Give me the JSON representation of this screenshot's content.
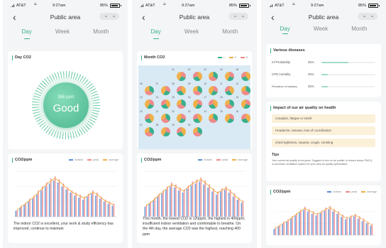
{
  "status_bar": {
    "carrier": "AT&T",
    "time": "9:27am",
    "battery": "85%"
  },
  "nav": {
    "title": "Public area"
  },
  "tabs": [
    "Day",
    "Week",
    "Month"
  ],
  "colors": {
    "accent": "#39b08d",
    "bottom": "#5b8fd6",
    "peak": "#ef8a8a",
    "average": "#f0b04a"
  },
  "screen1": {
    "active_tab": 0,
    "gauge": {
      "title": "Day CO2",
      "value": "356 ppm",
      "label": "Good"
    },
    "chart": {
      "title": "CO2/ppm"
    },
    "note": "The indoor CO2 is excellent, your work & study efficiency has improved, continue to maintain"
  },
  "screen2": {
    "active_tab": 2,
    "month": {
      "title": "Month CO2",
      "legend": [
        "1",
        "0",
        "8"
      ],
      "days": [
        {
          "d": "01"
        },
        {
          "d": "02"
        },
        {
          "d": "03"
        },
        {
          "d": "04"
        },
        {
          "d": "05"
        },
        {
          "d": "06"
        },
        {
          "d": "07"
        },
        {
          "d": "08"
        },
        {
          "d": "09"
        },
        {
          "d": "10"
        },
        {
          "d": "11"
        },
        {
          "d": "12"
        },
        {
          "d": "13"
        },
        {
          "d": "14"
        },
        {
          "d": "15"
        },
        {
          "d": "16"
        },
        {
          "d": "17"
        },
        {
          "d": "18"
        },
        {
          "d": "19"
        },
        {
          "d": "20"
        },
        {
          "d": "21"
        },
        {
          "d": "22"
        },
        {
          "d": "23"
        },
        {
          "d": "24"
        },
        {
          "d": "25"
        },
        {
          "d": "26"
        },
        {
          "d": "27"
        },
        {
          "d": "28"
        },
        {
          "d": "29"
        },
        {
          "d": "30"
        }
      ]
    },
    "chart": {
      "title": "CO2/ppm"
    },
    "note": "This month, the lowest CO2 is 120ppm, the highest is 400ppm, insufficient indoor ventilation and comfortable to breathe. On the 4th day, the average CO2 was the highest, reaching 400 ppm"
  },
  "screen3": {
    "active_tab": 0,
    "diseases": {
      "title": "Various diseases",
      "items": [
        {
          "name": "Inf Probability",
          "pct": "25%",
          "level": 0.5
        },
        {
          "name": "CPD mortality",
          "pct": "25%",
          "level": 0.12
        },
        {
          "name": "Prevalence of repiratory",
          "pct": "25%",
          "level": 0.12
        }
      ]
    },
    "impact": {
      "title": "Impact of our air quality on health",
      "items": [
        "complain, fatigue or smell",
        "Headache, nausea, loss of coordination",
        "chest tightness, nausea, cough, vomiting"
      ]
    },
    "tips": {
      "title": "Tips",
      "text": "Your current air quality is not good. Suggest to turn on air purifier to reduce indoor PM2.5, or purchase ventilation system for your area air quality optimization."
    },
    "chart": {
      "title": "CO2/ppm"
    }
  },
  "legend": {
    "bottom": "bottom",
    "peak": "peak",
    "average": "average"
  },
  "chart_data": [
    {
      "type": "bar",
      "title": "CO2/ppm",
      "series": [
        {
          "name": "bottom",
          "values": [
            12,
            18,
            24,
            30,
            36,
            44,
            52,
            60,
            66,
            72,
            68,
            60,
            54,
            48,
            42,
            38,
            34,
            40,
            46,
            42,
            36,
            30,
            26,
            22
          ]
        },
        {
          "name": "peak",
          "values": [
            14,
            22,
            28,
            36,
            42,
            52,
            60,
            68,
            76,
            80,
            74,
            66,
            58,
            52,
            48,
            44,
            40,
            46,
            52,
            48,
            40,
            34,
            30,
            26
          ]
        },
        {
          "name": "average",
          "values": [
            13,
            20,
            26,
            33,
            39,
            48,
            56,
            64,
            71,
            76,
            71,
            63,
            56,
            50,
            45,
            41,
            37,
            43,
            49,
            45,
            38,
            32,
            28,
            24
          ]
        }
      ]
    },
    {
      "type": "bar",
      "title": "CO2/ppm",
      "series": [
        {
          "name": "bottom",
          "values": [
            20,
            26,
            32,
            40,
            46,
            54,
            60,
            58,
            52,
            48,
            56,
            62,
            66,
            70,
            64,
            58,
            50,
            44,
            50,
            54,
            48,
            40,
            34,
            28
          ]
        },
        {
          "name": "peak",
          "values": [
            24,
            30,
            38,
            46,
            52,
            60,
            68,
            64,
            58,
            54,
            62,
            70,
            74,
            78,
            72,
            64,
            56,
            50,
            56,
            60,
            54,
            46,
            38,
            32
          ]
        },
        {
          "name": "average",
          "values": [
            22,
            28,
            35,
            43,
            49,
            57,
            64,
            61,
            55,
            51,
            59,
            66,
            70,
            74,
            68,
            61,
            53,
            47,
            53,
            57,
            51,
            43,
            36,
            30
          ]
        }
      ]
    },
    {
      "type": "bar",
      "title": "CO2/ppm",
      "series": [
        {
          "name": "bottom",
          "values": [
            16,
            22,
            28,
            34,
            42,
            50,
            58,
            64,
            60,
            54,
            50,
            56,
            62,
            66,
            60,
            54,
            46,
            40,
            44,
            48,
            42,
            36,
            30,
            24
          ]
        },
        {
          "name": "peak",
          "values": [
            20,
            26,
            34,
            40,
            48,
            56,
            64,
            72,
            66,
            60,
            56,
            62,
            70,
            74,
            66,
            60,
            52,
            46,
            50,
            54,
            48,
            42,
            34,
            28
          ]
        },
        {
          "name": "average",
          "values": [
            18,
            24,
            31,
            37,
            45,
            53,
            61,
            68,
            63,
            57,
            53,
            59,
            66,
            70,
            63,
            57,
            49,
            43,
            47,
            51,
            45,
            39,
            32,
            26
          ]
        }
      ]
    }
  ]
}
